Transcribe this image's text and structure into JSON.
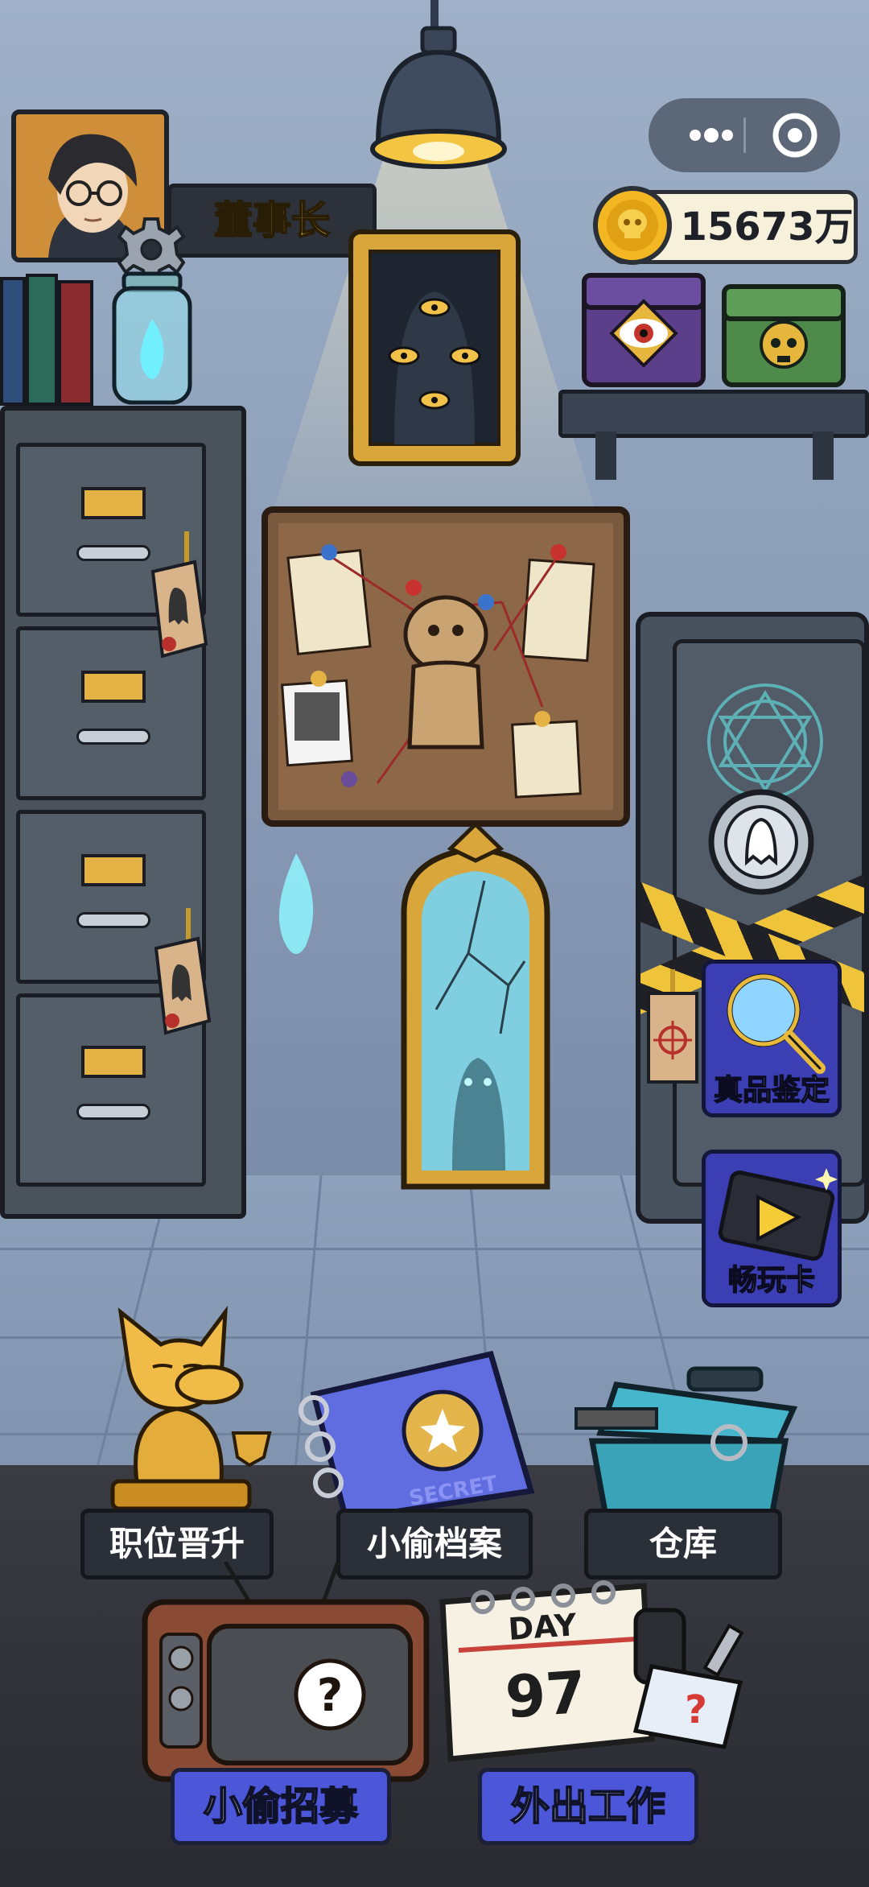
{
  "player": {
    "title": "董事长"
  },
  "currency": {
    "coins": "15673万",
    "icon": "skull-coin-icon"
  },
  "menu_capsule": {
    "more_icon": "more-dots-icon",
    "close_icon": "target-circle-icon"
  },
  "side_buttons": {
    "appraisal_label": "真品鉴定",
    "pass_label": "畅玩卡"
  },
  "room_labels": {
    "promotion": "职位晋升",
    "thief_files": "小偷档案",
    "warehouse": "仓库"
  },
  "bottom_buttons": {
    "recruit": "小偷招募",
    "go_out_work": "外出工作"
  },
  "calendar": {
    "day_label": "DAY",
    "day_number": "97"
  },
  "book": {
    "stamp": "SECRET"
  },
  "colors": {
    "wall": "#8fa2bd",
    "gold": "#f2c14a",
    "label_bg": "#2b2f37",
    "button_blue": "#4b57d8"
  }
}
